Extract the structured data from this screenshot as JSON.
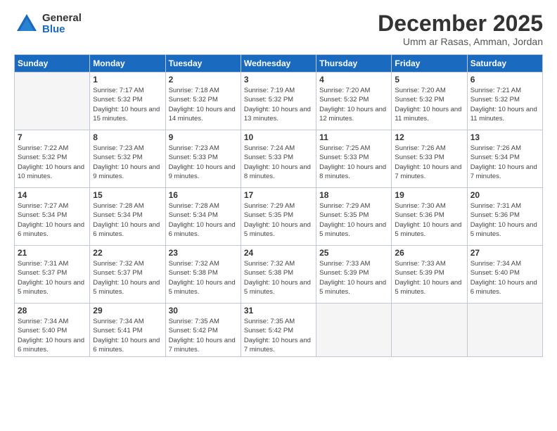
{
  "logo": {
    "general": "General",
    "blue": "Blue"
  },
  "header": {
    "month": "December 2025",
    "location": "Umm ar Rasas, Amman, Jordan"
  },
  "weekdays": [
    "Sunday",
    "Monday",
    "Tuesday",
    "Wednesday",
    "Thursday",
    "Friday",
    "Saturday"
  ],
  "weeks": [
    [
      {
        "day": "",
        "empty": true
      },
      {
        "day": "1",
        "sunrise": "7:17 AM",
        "sunset": "5:32 PM",
        "daylight": "10 hours and 15 minutes."
      },
      {
        "day": "2",
        "sunrise": "7:18 AM",
        "sunset": "5:32 PM",
        "daylight": "10 hours and 14 minutes."
      },
      {
        "day": "3",
        "sunrise": "7:19 AM",
        "sunset": "5:32 PM",
        "daylight": "10 hours and 13 minutes."
      },
      {
        "day": "4",
        "sunrise": "7:20 AM",
        "sunset": "5:32 PM",
        "daylight": "10 hours and 12 minutes."
      },
      {
        "day": "5",
        "sunrise": "7:20 AM",
        "sunset": "5:32 PM",
        "daylight": "10 hours and 11 minutes."
      },
      {
        "day": "6",
        "sunrise": "7:21 AM",
        "sunset": "5:32 PM",
        "daylight": "10 hours and 11 minutes."
      }
    ],
    [
      {
        "day": "7",
        "sunrise": "7:22 AM",
        "sunset": "5:32 PM",
        "daylight": "10 hours and 10 minutes."
      },
      {
        "day": "8",
        "sunrise": "7:23 AM",
        "sunset": "5:32 PM",
        "daylight": "10 hours and 9 minutes."
      },
      {
        "day": "9",
        "sunrise": "7:23 AM",
        "sunset": "5:33 PM",
        "daylight": "10 hours and 9 minutes."
      },
      {
        "day": "10",
        "sunrise": "7:24 AM",
        "sunset": "5:33 PM",
        "daylight": "10 hours and 8 minutes."
      },
      {
        "day": "11",
        "sunrise": "7:25 AM",
        "sunset": "5:33 PM",
        "daylight": "10 hours and 8 minutes."
      },
      {
        "day": "12",
        "sunrise": "7:26 AM",
        "sunset": "5:33 PM",
        "daylight": "10 hours and 7 minutes."
      },
      {
        "day": "13",
        "sunrise": "7:26 AM",
        "sunset": "5:34 PM",
        "daylight": "10 hours and 7 minutes."
      }
    ],
    [
      {
        "day": "14",
        "sunrise": "7:27 AM",
        "sunset": "5:34 PM",
        "daylight": "10 hours and 6 minutes."
      },
      {
        "day": "15",
        "sunrise": "7:28 AM",
        "sunset": "5:34 PM",
        "daylight": "10 hours and 6 minutes."
      },
      {
        "day": "16",
        "sunrise": "7:28 AM",
        "sunset": "5:34 PM",
        "daylight": "10 hours and 6 minutes."
      },
      {
        "day": "17",
        "sunrise": "7:29 AM",
        "sunset": "5:35 PM",
        "daylight": "10 hours and 5 minutes."
      },
      {
        "day": "18",
        "sunrise": "7:29 AM",
        "sunset": "5:35 PM",
        "daylight": "10 hours and 5 minutes."
      },
      {
        "day": "19",
        "sunrise": "7:30 AM",
        "sunset": "5:36 PM",
        "daylight": "10 hours and 5 minutes."
      },
      {
        "day": "20",
        "sunrise": "7:31 AM",
        "sunset": "5:36 PM",
        "daylight": "10 hours and 5 minutes."
      }
    ],
    [
      {
        "day": "21",
        "sunrise": "7:31 AM",
        "sunset": "5:37 PM",
        "daylight": "10 hours and 5 minutes."
      },
      {
        "day": "22",
        "sunrise": "7:32 AM",
        "sunset": "5:37 PM",
        "daylight": "10 hours and 5 minutes."
      },
      {
        "day": "23",
        "sunrise": "7:32 AM",
        "sunset": "5:38 PM",
        "daylight": "10 hours and 5 minutes."
      },
      {
        "day": "24",
        "sunrise": "7:32 AM",
        "sunset": "5:38 PM",
        "daylight": "10 hours and 5 minutes."
      },
      {
        "day": "25",
        "sunrise": "7:33 AM",
        "sunset": "5:39 PM",
        "daylight": "10 hours and 5 minutes."
      },
      {
        "day": "26",
        "sunrise": "7:33 AM",
        "sunset": "5:39 PM",
        "daylight": "10 hours and 5 minutes."
      },
      {
        "day": "27",
        "sunrise": "7:34 AM",
        "sunset": "5:40 PM",
        "daylight": "10 hours and 6 minutes."
      }
    ],
    [
      {
        "day": "28",
        "sunrise": "7:34 AM",
        "sunset": "5:40 PM",
        "daylight": "10 hours and 6 minutes."
      },
      {
        "day": "29",
        "sunrise": "7:34 AM",
        "sunset": "5:41 PM",
        "daylight": "10 hours and 6 minutes."
      },
      {
        "day": "30",
        "sunrise": "7:35 AM",
        "sunset": "5:42 PM",
        "daylight": "10 hours and 7 minutes."
      },
      {
        "day": "31",
        "sunrise": "7:35 AM",
        "sunset": "5:42 PM",
        "daylight": "10 hours and 7 minutes."
      },
      {
        "day": "",
        "empty": true
      },
      {
        "day": "",
        "empty": true
      },
      {
        "day": "",
        "empty": true
      }
    ]
  ]
}
